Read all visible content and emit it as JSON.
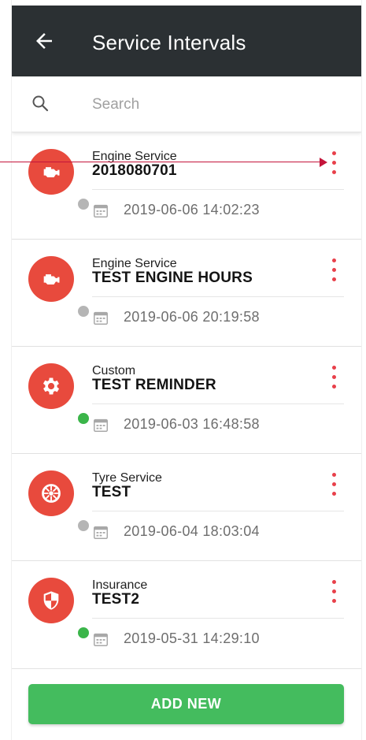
{
  "app": {
    "title": "Service Intervals"
  },
  "search": {
    "placeholder": "Search",
    "value": ""
  },
  "intervals": [
    {
      "category": "Engine Service",
      "name": "2018080701",
      "date": "2019-06-06 14:02:23",
      "icon": "engine-icon",
      "status": "inactive"
    },
    {
      "category": "Engine Service",
      "name": "TEST ENGINE HOURS",
      "date": "2019-06-06 20:19:58",
      "icon": "engine-icon",
      "status": "inactive"
    },
    {
      "category": "Custom",
      "name": "TEST REMINDER",
      "date": "2019-06-03 16:48:58",
      "icon": "gear-icon",
      "status": "active"
    },
    {
      "category": "Tyre Service",
      "name": "TEST",
      "date": "2019-06-04 18:03:04",
      "icon": "tyre-icon",
      "status": "inactive"
    },
    {
      "category": "Insurance",
      "name": "TEST2",
      "date": "2019-05-31 14:29:10",
      "icon": "shield-icon",
      "status": "active"
    }
  ],
  "footer": {
    "add_label": "ADD NEW"
  },
  "colors": {
    "appbar": "#2b3033",
    "avatar": "#e84a3d",
    "status_active": "#3bb54a",
    "status_inactive": "#b5b5b5",
    "more_dots": "#e8404a",
    "add_button": "#44bc5e",
    "callout": "#c4143a"
  }
}
